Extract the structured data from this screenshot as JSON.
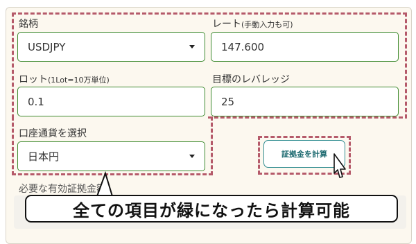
{
  "form": {
    "symbol_label": "銘柄",
    "symbol_value": "USDJPY",
    "rate_label": "レート",
    "rate_note": "(手動入力も可)",
    "rate_value": "147.600",
    "lot_label": "ロット",
    "lot_note": "(1Lot=10万単位)",
    "lot_value": "0.1",
    "leverage_label": "目標のレバレッジ",
    "leverage_value": "25",
    "currency_label": "口座通貨を選択",
    "currency_value": "日本円",
    "calc_button": "証拠金を計算",
    "margin_label": "必要な有効証拠金額"
  },
  "annotation": {
    "callout_text": "全ての項目が緑になったら計算可能",
    "highlight_color": "#b55a6a"
  },
  "colors": {
    "valid_border": "#3d8a2e",
    "button_border": "#2f8c90",
    "card_bg": "#fcf8ef"
  },
  "icons": [
    "chevron-down-icon",
    "cursor-pointer-icon"
  ]
}
